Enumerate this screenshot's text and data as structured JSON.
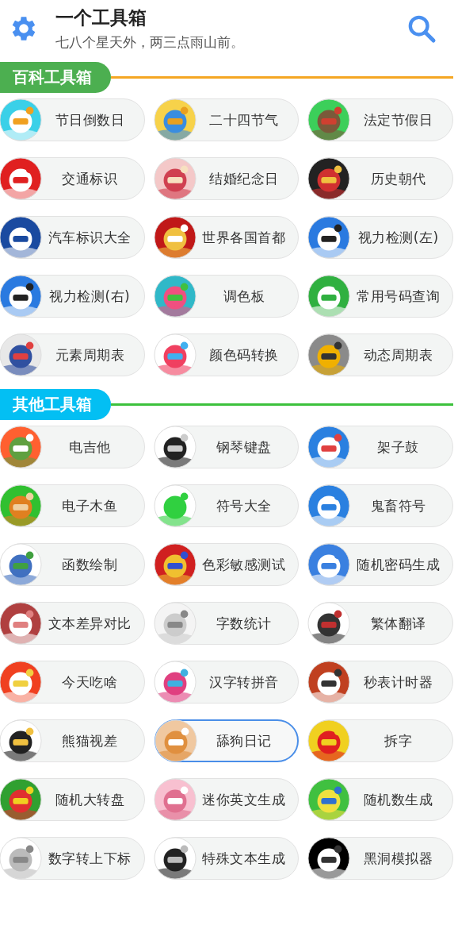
{
  "header": {
    "title": "一个工具箱",
    "subtitle": "七八个星天外，两三点雨山前。"
  },
  "sections": [
    {
      "title": "百科工具箱",
      "color": "#4caf50",
      "rule": {
        "color": "#f5a623"
      },
      "tools": [
        {
          "label": "节日倒数日",
          "selected": false
        },
        {
          "label": "二十四节气",
          "selected": false
        },
        {
          "label": "法定节假日",
          "selected": false
        },
        {
          "label": "交通标识",
          "selected": false
        },
        {
          "label": "结婚纪念日",
          "selected": false
        },
        {
          "label": "历史朝代",
          "selected": false
        },
        {
          "label": "汽车标识大全",
          "selected": false
        },
        {
          "label": "世界各国首都",
          "selected": false
        },
        {
          "label": "视力检测(左)",
          "selected": false
        },
        {
          "label": "视力检测(右)",
          "selected": false
        },
        {
          "label": "调色板",
          "selected": false
        },
        {
          "label": "常用号码查询",
          "selected": false
        },
        {
          "label": "元素周期表",
          "selected": false
        },
        {
          "label": "颜色码转换",
          "selected": false
        },
        {
          "label": "动态周期表",
          "selected": false
        }
      ]
    },
    {
      "title": "其他工具箱",
      "color": "#03bff3",
      "rule": {
        "color": "#3cc13c"
      },
      "tools": [
        {
          "label": "电吉他",
          "selected": false
        },
        {
          "label": "钢琴键盘",
          "selected": false
        },
        {
          "label": "架子鼓",
          "selected": false
        },
        {
          "label": "电子木鱼",
          "selected": false
        },
        {
          "label": "符号大全",
          "selected": false
        },
        {
          "label": "鬼畜符号",
          "selected": false
        },
        {
          "label": "函数绘制",
          "selected": false
        },
        {
          "label": "色彩敏感测试",
          "selected": false
        },
        {
          "label": "随机密码生成",
          "selected": false
        },
        {
          "label": "文本差异对比",
          "selected": false
        },
        {
          "label": "字数统计",
          "selected": false
        },
        {
          "label": "繁体翻译",
          "selected": false
        },
        {
          "label": "今天吃啥",
          "selected": false
        },
        {
          "label": "汉字转拼音",
          "selected": false
        },
        {
          "label": "秒表计时器",
          "selected": false
        },
        {
          "label": "熊猫视差",
          "selected": false
        },
        {
          "label": "舔狗日记",
          "selected": true
        },
        {
          "label": "拆字",
          "selected": false
        },
        {
          "label": "随机大转盘",
          "selected": false
        },
        {
          "label": "迷你英文生成",
          "selected": false
        },
        {
          "label": "随机数生成",
          "selected": false
        },
        {
          "label": "数字转上下标",
          "selected": false
        },
        {
          "label": "特殊文本生成",
          "selected": false
        },
        {
          "label": "黑洞模拟器",
          "selected": false
        }
      ]
    }
  ]
}
